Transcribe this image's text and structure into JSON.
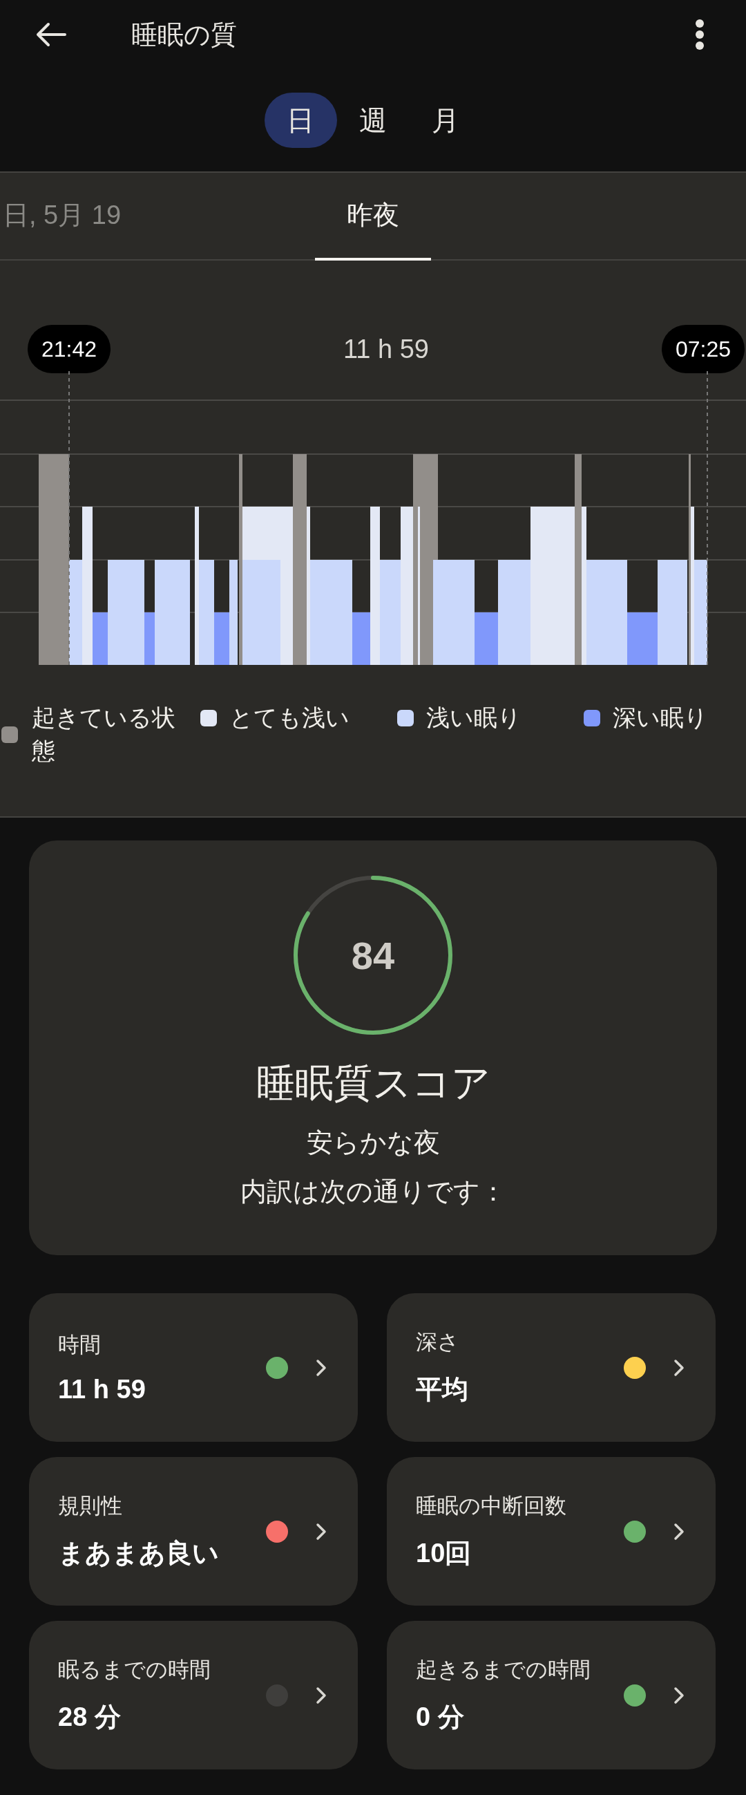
{
  "app_bar": {
    "title": "睡眠の質"
  },
  "period_tabs": [
    {
      "label": "日",
      "selected": true
    },
    {
      "label": "週",
      "selected": false
    },
    {
      "label": "月",
      "selected": false
    }
  ],
  "night_tabs": [
    {
      "label": "日, 5月 19",
      "selected": false
    },
    {
      "label": "昨夜",
      "selected": true
    }
  ],
  "hypnogram": {
    "start_time": "21:42",
    "duration": "11 h 59",
    "end_time": "07:25",
    "legend": [
      {
        "label": "起きている状態",
        "color": "#928e8a"
      },
      {
        "label": "とても浅い",
        "color": "#e3e8f5"
      },
      {
        "label": "浅い眠り",
        "color": "#cad8fb"
      },
      {
        "label": "深い眠り",
        "color": "#8098fb"
      }
    ]
  },
  "score_card": {
    "score": "84",
    "level": 0.84,
    "title": "睡眠質スコア",
    "verdict": "安らかな夜",
    "note": "内訳は次の通りです："
  },
  "metrics": [
    {
      "label": "時間",
      "value": "11 h 59",
      "color": "#6ab26b"
    },
    {
      "label": "深さ",
      "value": "平均",
      "color": "#fdd04f"
    },
    {
      "label": "規則性",
      "value": "まあまあ良い",
      "color": "#f7706a"
    },
    {
      "label": "睡眠の中断回数",
      "value": "10回",
      "color": "#6ab26b"
    },
    {
      "label": "眠るまでの時間",
      "value": "28 分",
      "color": "#3f3e3c"
    },
    {
      "label": "起きるまでの時間",
      "value": "0 分",
      "color": "#6ab26b"
    }
  ]
}
